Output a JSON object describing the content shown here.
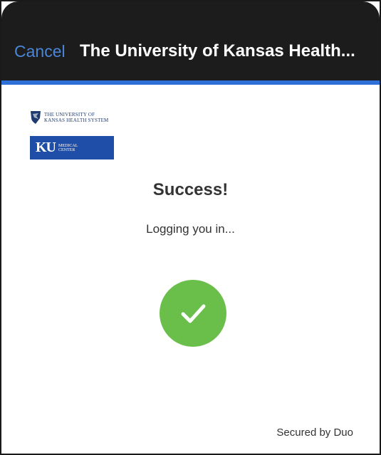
{
  "header": {
    "cancel_label": "Cancel",
    "title": "The University of Kansas Health..."
  },
  "logos": {
    "health_system_line1": "The University of",
    "health_system_line2": "Kansas Health System",
    "ku_letters": "KU",
    "medical_center_line1": "Medical",
    "medical_center_line2": "Center"
  },
  "main": {
    "heading": "Success!",
    "status": "Logging you in...",
    "status_icon": "check-circle-icon"
  },
  "footer": {
    "secured_label": "Secured by Duo"
  },
  "colors": {
    "header_bg": "#1c1c1c",
    "cancel_blue": "#4a86d8",
    "accent_line": "#2f6fd8",
    "ku_blue": "#1f4ea8",
    "success_green": "#6abf4b"
  }
}
